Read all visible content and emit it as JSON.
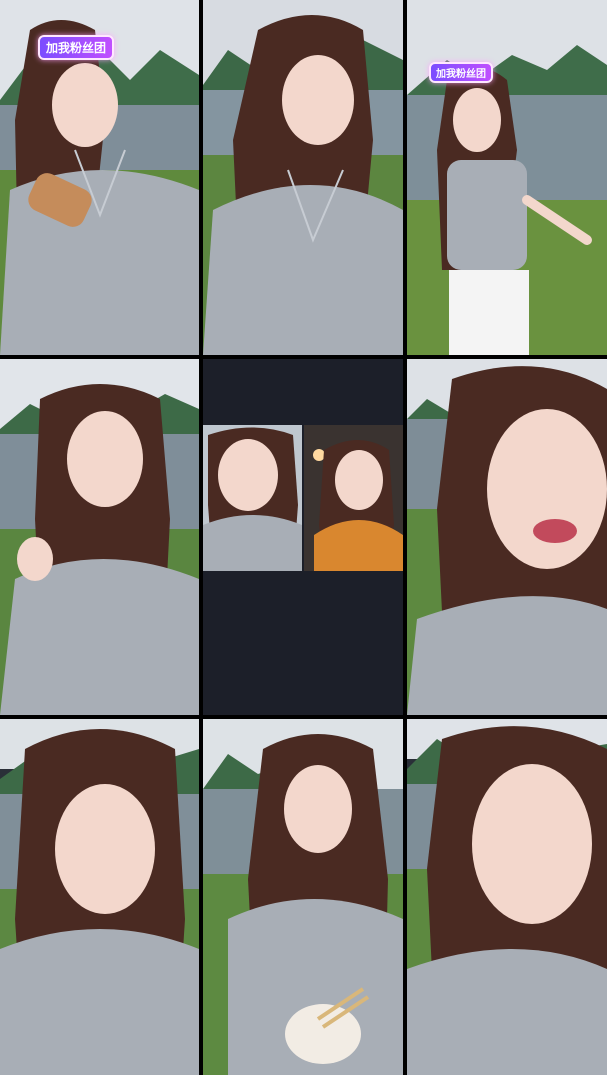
{
  "badges": {
    "tile1": "加我粉丝团",
    "tile3": "加我粉丝团"
  },
  "colors": {
    "background": "#000000",
    "center_panel": "#1c1f29",
    "sky": "#d9dde3",
    "water": "#7f8e99",
    "hills": "#3f6d4a",
    "grass": "#5f8a3d",
    "cardigan": "#a8aeb6",
    "hair": "#4a2a22",
    "skin": "#f3d7cc",
    "badge_start": "#7b4dff",
    "badge_end": "#c04fff"
  },
  "tiles": [
    {
      "name": "stream-tile-1",
      "scene": "lakeside-hair-brush"
    },
    {
      "name": "stream-tile-2",
      "scene": "lakeside-talking"
    },
    {
      "name": "stream-tile-3",
      "scene": "lakeside-dancing"
    },
    {
      "name": "stream-tile-4",
      "scene": "lakeside-hand-in-hair"
    },
    {
      "name": "stream-tile-5",
      "scene": "video-call-split"
    },
    {
      "name": "stream-tile-6",
      "scene": "closeup-talking"
    },
    {
      "name": "stream-tile-7",
      "scene": "closeup-talking"
    },
    {
      "name": "stream-tile-8",
      "scene": "eating-noodles"
    },
    {
      "name": "stream-tile-9",
      "scene": "closeup-talking"
    }
  ]
}
